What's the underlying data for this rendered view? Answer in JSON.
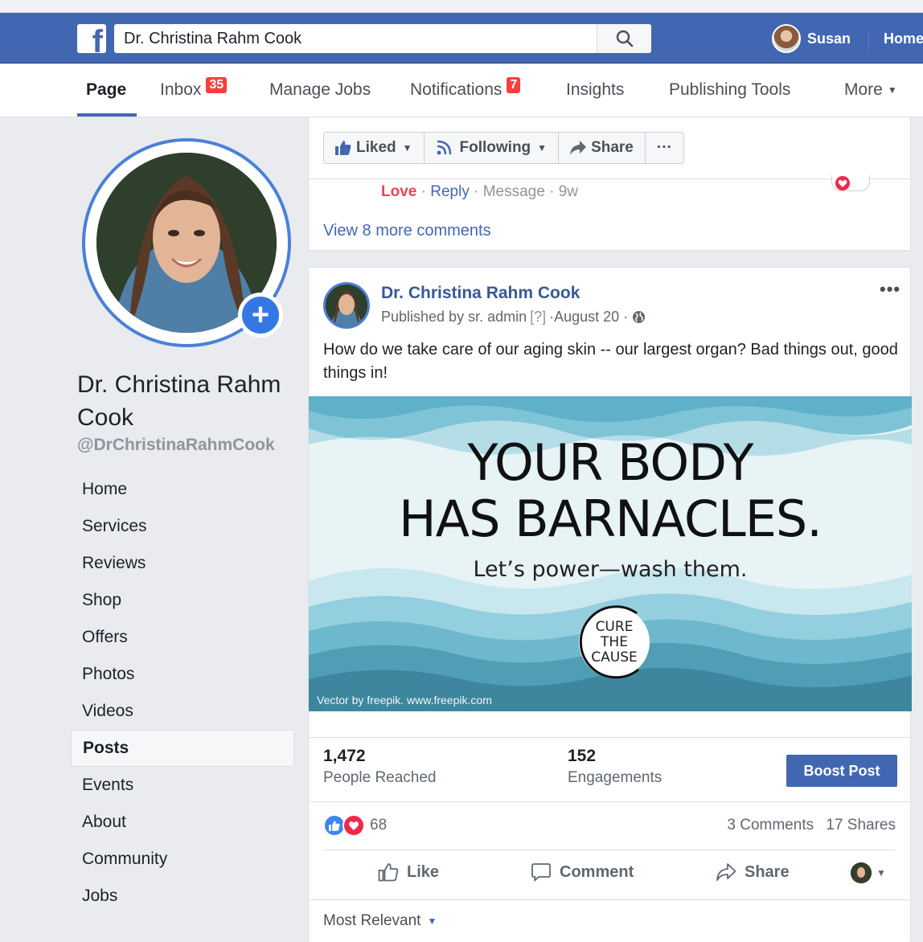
{
  "topbar": {
    "logo": "f",
    "search_value": "Dr. Christina Rahm Cook",
    "user_name": "Susan",
    "home_label": "Home"
  },
  "pagenav": {
    "tabs": [
      {
        "label": "Page"
      },
      {
        "label": "Inbox",
        "badge": "35"
      },
      {
        "label": "Manage Jobs"
      },
      {
        "label": "Notifications",
        "badge": "7"
      },
      {
        "label": "Insights"
      },
      {
        "label": "Publishing Tools"
      },
      {
        "label": "More"
      }
    ]
  },
  "profile": {
    "name": "Dr. Christina Rahm Cook",
    "handle": "@DrChristinaRahmCook",
    "add_icon": "+"
  },
  "sidenav": {
    "items": [
      "Home",
      "Services",
      "Reviews",
      "Shop",
      "Offers",
      "Photos",
      "Videos",
      "Posts",
      "Events",
      "About",
      "Community",
      "Jobs"
    ],
    "active": "Posts"
  },
  "actionbar": {
    "liked": "Liked",
    "following": "Following",
    "share": "Share",
    "more": "···"
  },
  "prev_comment": {
    "love": "Love",
    "reply": "Reply",
    "message": "Message",
    "time": "9w",
    "view_more": "View 8 more comments"
  },
  "post": {
    "author": "Dr. Christina Rahm Cook",
    "published_by": "Published by sr. admin",
    "help": "[?]",
    "date": "August 20",
    "dots": "•••",
    "text": "How do we take care of our aging skin -- our largest organ? Bad things out, good things in!",
    "image": {
      "headline_1": "YOUR BODY",
      "headline_2": "HAS BARNACLES.",
      "subline": "Let’s power—wash them.",
      "logo_1": "CURE",
      "logo_2": "THE",
      "logo_3": "CAUSE",
      "credit": "Vector by freepik. www.freepik.com"
    },
    "stats": {
      "reached_num": "1,472",
      "reached_label": "People Reached",
      "engagements_num": "152",
      "engagements_label": "Engagements",
      "boost_label": "Boost Post"
    },
    "reactions_count": "68",
    "comments": "3 Comments",
    "shares": "17 Shares",
    "actions": {
      "like": "Like",
      "comment": "Comment",
      "share": "Share"
    },
    "sort_label": "Most Relevant"
  },
  "colors": {
    "brand_blue": "#4267b2",
    "badge_red": "#fa3e3e",
    "love_red": "#f33e58",
    "link_blue": "#385898"
  }
}
